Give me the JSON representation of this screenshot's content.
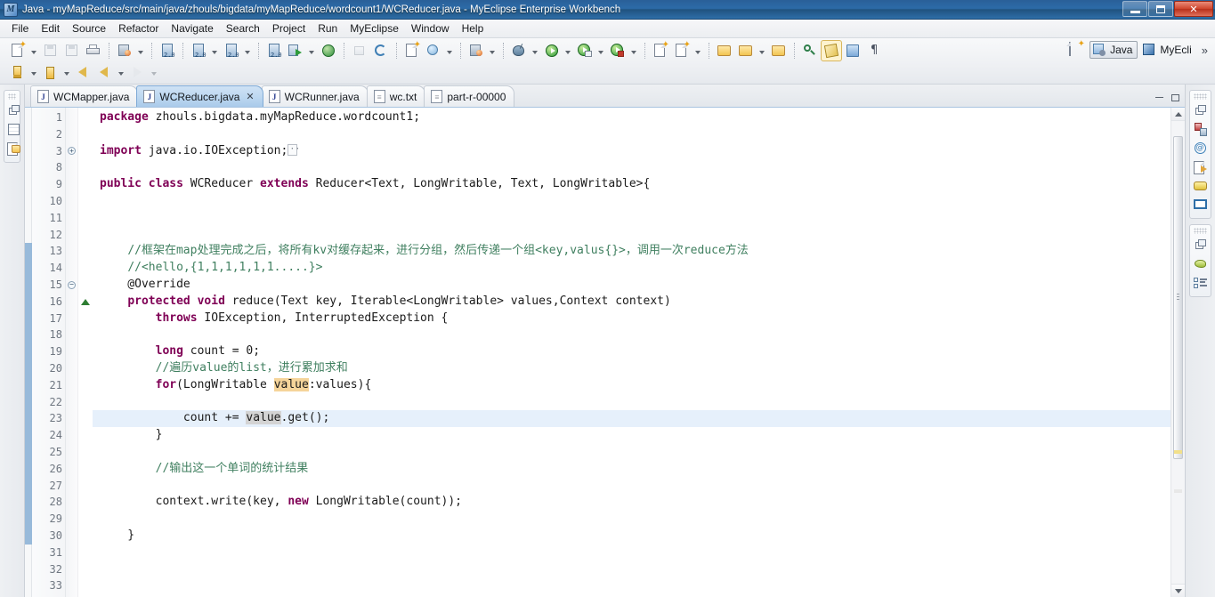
{
  "window": {
    "title": "Java - myMapReduce/src/main/java/zhouls/bigdata/myMapReduce/wordcount1/WCReducer.java - MyEclipse Enterprise Workbench",
    "app_icon": "myeclipse-icon",
    "buttons": {
      "minimize": "minimize-button",
      "restore": "restore-button",
      "close": "close-button"
    }
  },
  "menubar": {
    "items": [
      {
        "label": "File"
      },
      {
        "label": "Edit"
      },
      {
        "label": "Source"
      },
      {
        "label": "Refactor"
      },
      {
        "label": "Navigate"
      },
      {
        "label": "Search"
      },
      {
        "label": "Project"
      },
      {
        "label": "Run"
      },
      {
        "label": "MyEclipse"
      },
      {
        "label": "Window"
      },
      {
        "label": "Help"
      }
    ]
  },
  "toolbar": {
    "row1": [
      {
        "icon": "new-wizard-icon",
        "dropdown": true,
        "disabled": false
      },
      {
        "icon": "save-icon",
        "dropdown": false,
        "disabled": true
      },
      {
        "icon": "save-all-icon",
        "dropdown": false,
        "disabled": true
      },
      {
        "icon": "print-icon",
        "dropdown": false,
        "disabled": false
      },
      {
        "sep": true
      },
      {
        "icon": "deploy-icon",
        "dropdown": true,
        "disabled": false
      },
      {
        "sep": true
      },
      {
        "icon": "server-2.0-icon",
        "dropdown": false,
        "disabled": false
      },
      {
        "sep": true
      },
      {
        "icon": "new-server-icon",
        "dropdown": true,
        "disabled": false
      },
      {
        "icon": "manage-server-icon",
        "dropdown": true,
        "disabled": false
      },
      {
        "sep": true
      },
      {
        "icon": "database-explorer-icon",
        "dropdown": false,
        "disabled": false
      },
      {
        "icon": "run-sql-icon",
        "dropdown": true,
        "disabled": false
      },
      {
        "icon": "web-browser-icon",
        "dropdown": false,
        "disabled": false
      },
      {
        "sep": true
      },
      {
        "icon": "upload-icon",
        "dropdown": false,
        "disabled": true
      },
      {
        "icon": "refresh-icon",
        "dropdown": false,
        "disabled": false
      },
      {
        "sep": true
      },
      {
        "icon": "report-icon",
        "dropdown": false,
        "disabled": false
      },
      {
        "icon": "uml-icon",
        "dropdown": true,
        "disabled": false
      },
      {
        "sep": true
      },
      {
        "icon": "snapshot-icon",
        "dropdown": true,
        "disabled": false
      },
      {
        "sep": true
      },
      {
        "icon": "debug-icon",
        "dropdown": true,
        "disabled": false
      },
      {
        "icon": "run-icon",
        "dropdown": true,
        "disabled": false
      },
      {
        "icon": "run-config-icon",
        "dropdown": true,
        "disabled": false
      },
      {
        "icon": "run-secure-icon",
        "dropdown": true,
        "disabled": false
      },
      {
        "sep": true
      },
      {
        "icon": "new-package-icon",
        "dropdown": false,
        "disabled": false
      },
      {
        "icon": "new-annotation-icon",
        "dropdown": true,
        "disabled": false
      },
      {
        "sep": true
      },
      {
        "icon": "open-type-icon",
        "dropdown": false,
        "disabled": false
      },
      {
        "icon": "open-task-icon",
        "dropdown": true,
        "disabled": false
      },
      {
        "icon": "open-resource-icon",
        "dropdown": false,
        "disabled": false
      },
      {
        "sep": true
      },
      {
        "icon": "search-icon",
        "dropdown": false,
        "disabled": false
      },
      {
        "icon": "toggle-mark-occurrences-icon",
        "dropdown": false,
        "disabled": false,
        "pressed": true
      },
      {
        "icon": "show-source-icon",
        "dropdown": false,
        "disabled": false
      },
      {
        "icon": "show-whitespace-icon",
        "dropdown": false,
        "disabled": false
      }
    ],
    "row2": [
      {
        "icon": "import-icon",
        "dropdown": true,
        "disabled": false
      },
      {
        "icon": "export-icon",
        "dropdown": true,
        "disabled": false
      },
      {
        "icon": "back-icon",
        "dropdown": false,
        "disabled": false
      },
      {
        "icon": "previous-annotation-icon",
        "dropdown": true,
        "disabled": false
      },
      {
        "icon": "forward-icon",
        "dropdown": true,
        "disabled": true
      }
    ],
    "perspective": {
      "open_perspective_label": "open-perspective-icon",
      "items": [
        {
          "label": "Java",
          "icon": "java-perspective-icon",
          "active": true
        },
        {
          "label": "MyEcli",
          "icon": "myeclipse-perspective-icon",
          "active": false
        }
      ],
      "overflow": "»"
    }
  },
  "leftbar": {
    "group": {
      "icons": [
        "restore-view-icon",
        "package-explorer-icon",
        "project-explorer-icon"
      ]
    }
  },
  "rightbar": {
    "groups": [
      {
        "icons": [
          "restore-view-icon",
          "servers-icon",
          "email-icon",
          "snippets-icon",
          "db-browser-icon",
          "console-icon"
        ]
      },
      {
        "icons": [
          "restore-view-icon",
          "outline-icon",
          "task-list-icon"
        ]
      }
    ]
  },
  "editor": {
    "tabs": [
      {
        "label": "WCMapper.java",
        "icon": "java-file-icon",
        "active": false,
        "closable": false
      },
      {
        "label": "WCReducer.java",
        "icon": "java-file-icon",
        "active": true,
        "closable": true,
        "close_glyph": "✕"
      },
      {
        "label": "WCRunner.java",
        "icon": "java-file-icon",
        "active": false,
        "closable": false
      },
      {
        "label": "wc.txt",
        "icon": "text-file-icon",
        "active": false,
        "closable": false
      },
      {
        "label": "part-r-00000",
        "icon": "text-file-icon",
        "active": false,
        "closable": false
      }
    ],
    "view_buttons": [
      "minimize-view-button",
      "maximize-view-button"
    ],
    "current_line": 23,
    "first_line_number": 1,
    "change_bar_range": [
      13,
      30
    ],
    "lines": [
      {
        "n": 1,
        "fold": "none",
        "marker": "none",
        "html": "<span class=\"kw\">package</span> zhouls.bigdata.myMapReduce.wordcount1;"
      },
      {
        "n": 2,
        "fold": "none",
        "marker": "none",
        "html": ""
      },
      {
        "n": 3,
        "fold": "expand",
        "marker": "none",
        "html": "<span class=\"kw\">import</span> java.io.IOException;<span class=\"foldmark\"></span>"
      },
      {
        "n": 8,
        "fold": "none",
        "marker": "none",
        "html": ""
      },
      {
        "n": 9,
        "fold": "none",
        "marker": "none",
        "html": "<span class=\"kw\">public</span> <span class=\"kw\">class</span> WCReducer <span class=\"kw\">extends</span> Reducer&lt;Text, LongWritable, Text, LongWritable&gt;{"
      },
      {
        "n": 10,
        "fold": "none",
        "marker": "none",
        "html": ""
      },
      {
        "n": 11,
        "fold": "none",
        "marker": "none",
        "html": ""
      },
      {
        "n": 12,
        "fold": "none",
        "marker": "none",
        "html": ""
      },
      {
        "n": 13,
        "fold": "none",
        "marker": "none",
        "html": "    <span class=\"cmt\">//框架在map处理完成之后，将所有kv对缓存起来，进行分组，然后传递一个组&lt;key,valus{}&gt;，调用一次reduce方法</span>"
      },
      {
        "n": 14,
        "fold": "none",
        "marker": "none",
        "html": "    <span class=\"cmt\">//&lt;hello,{1,1,1,1,1,1.....}&gt;</span>"
      },
      {
        "n": 15,
        "fold": "collapse",
        "marker": "none",
        "html": "    @Override"
      },
      {
        "n": 16,
        "fold": "none",
        "marker": "override",
        "html": "    <span class=\"kw\">protected</span> <span class=\"kw\">void</span> reduce(Text key, Iterable&lt;LongWritable&gt; values,Context context)"
      },
      {
        "n": 17,
        "fold": "none",
        "marker": "none",
        "html": "        <span class=\"kw\">throws</span> IOException, InterruptedException {"
      },
      {
        "n": 18,
        "fold": "none",
        "marker": "none",
        "html": ""
      },
      {
        "n": 19,
        "fold": "none",
        "marker": "none",
        "html": "        <span class=\"kw\">long</span> count = 0;"
      },
      {
        "n": 20,
        "fold": "none",
        "marker": "none",
        "html": "        <span class=\"cmt\">//遍历value的list，进行累加求和</span>"
      },
      {
        "n": 21,
        "fold": "none",
        "marker": "none",
        "html": "        <span class=\"kw\">for</span>(LongWritable <span class=\"hl-write\">value</span>:values){"
      },
      {
        "n": 22,
        "fold": "none",
        "marker": "none",
        "html": ""
      },
      {
        "n": 23,
        "fold": "none",
        "marker": "none",
        "html": "            count += <span class=\"hl-read\">value</span>.get();"
      },
      {
        "n": 24,
        "fold": "none",
        "marker": "none",
        "html": "        }"
      },
      {
        "n": 25,
        "fold": "none",
        "marker": "none",
        "html": ""
      },
      {
        "n": 26,
        "fold": "none",
        "marker": "none",
        "html": "        <span class=\"cmt\">//输出这一个单词的统计结果</span>"
      },
      {
        "n": 27,
        "fold": "none",
        "marker": "none",
        "html": ""
      },
      {
        "n": 28,
        "fold": "none",
        "marker": "none",
        "html": "        context.write(key, <span class=\"kw\">new</span> LongWritable(count));"
      },
      {
        "n": 29,
        "fold": "none",
        "marker": "none",
        "html": ""
      },
      {
        "n": 30,
        "fold": "none",
        "marker": "none",
        "html": "    }"
      },
      {
        "n": 31,
        "fold": "none",
        "marker": "none",
        "html": ""
      },
      {
        "n": 32,
        "fold": "none",
        "marker": "none",
        "html": ""
      },
      {
        "n": 33,
        "fold": "none",
        "marker": "none",
        "html": ""
      }
    ],
    "scrollbar": {
      "thumb_top_pct": 3,
      "thumb_height_pct": 66,
      "overview_marks": [
        {
          "color": "#f2e08a",
          "top_pct": 70
        },
        {
          "color": "#e8e8e8",
          "top_pct": 78
        }
      ]
    }
  },
  "colors": {
    "title_bar": "#2c6ba8",
    "active_tab": "#bcd7f0",
    "keyword": "#7f0055",
    "comment": "#3f7f5f",
    "current_line": "#e6f0fb",
    "occurrence_write": "#f5d49a",
    "occurrence_read": "#d4d4d4",
    "change_bar": "#7ba7cf"
  }
}
